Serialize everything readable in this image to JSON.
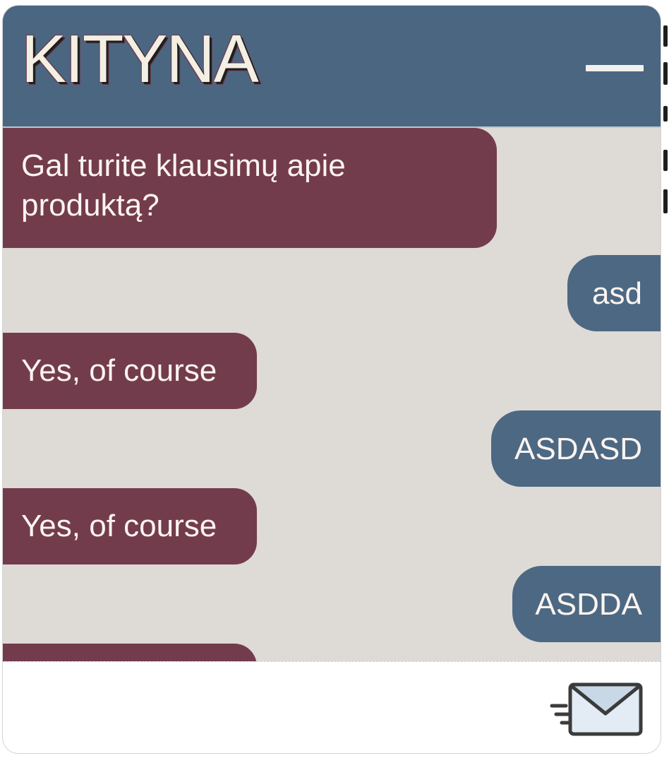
{
  "chat": {
    "title": "KITYNA",
    "minimize_icon": "minimize-icon",
    "send_icon": "send-mail-icon",
    "input_placeholder": "",
    "messages": [
      {
        "sender": "bot",
        "text": "Gal turite klausimų apie produktą?"
      },
      {
        "sender": "user",
        "text": "asd"
      },
      {
        "sender": "bot",
        "text": "Yes, of course"
      },
      {
        "sender": "user",
        "text": "ASDASD"
      },
      {
        "sender": "bot",
        "text": "Yes, of course"
      },
      {
        "sender": "user",
        "text": "ASDDA"
      },
      {
        "sender": "bot",
        "text": ""
      }
    ]
  },
  "colors": {
    "header_bg": "#4b6681",
    "bot_bubble": "#733c4c",
    "user_bubble": "#4d6882",
    "chat_bg": "#dedad6",
    "title_text": "#f4efe3"
  }
}
